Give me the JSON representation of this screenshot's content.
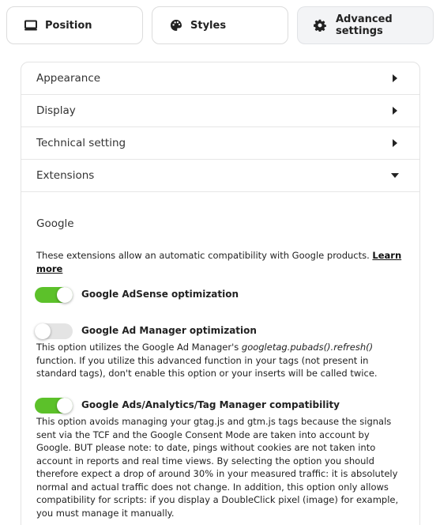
{
  "tabs": [
    {
      "label": "Position",
      "icon": "monitor-icon"
    },
    {
      "label": "Styles",
      "icon": "palette-icon"
    },
    {
      "label": "Advanced settings",
      "icon": "gear-icon",
      "active": true
    }
  ],
  "accordion": [
    {
      "label": "Appearance",
      "expanded": false
    },
    {
      "label": "Display",
      "expanded": false
    },
    {
      "label": "Technical setting",
      "expanded": false
    },
    {
      "label": "Extensions",
      "expanded": true
    }
  ],
  "extensions": {
    "section_title": "Google",
    "intro_text": "These extensions allow an automatic compatibility with Google products. ",
    "intro_link": "Learn more",
    "options": [
      {
        "label": "Google AdSense optimization",
        "enabled": true,
        "desc_before": "",
        "desc_code": "",
        "desc_after": ""
      },
      {
        "label": "Google Ad Manager optimization",
        "enabled": false,
        "desc_before": "This option utilizes the Google Ad Manager's ",
        "desc_code": "googletag.pubads().refresh()",
        "desc_after": " function. If you utilize this advanced function in your tags (not present in standard tags), don't enable this option or your inserts will be called twice."
      },
      {
        "label": "Google Ads/Analytics/Tag Manager compatibility",
        "enabled": true,
        "desc_before": "This option avoids managing your gtag.js and gtm.js tags because the signals sent via the TCF and the Google Consent Mode are taken into account by Google. BUT please note: to date, pings without cookies are not taken into account in reports and real time views. By selecting the option you should therefore expect a drop of around 30% in your measured traffic: it is absolutely normal and actual traffic does not change. In addition, this option only allows compatibility for scripts: if you display a DoubleClick pixel (image) for example, you must manage it manually.",
        "desc_code": "",
        "desc_after": ""
      }
    ]
  },
  "colors": {
    "toggle_on": "#5cc12a",
    "toggle_off": "#e4e4e4",
    "active_tab_bg": "#f3f4f6"
  }
}
